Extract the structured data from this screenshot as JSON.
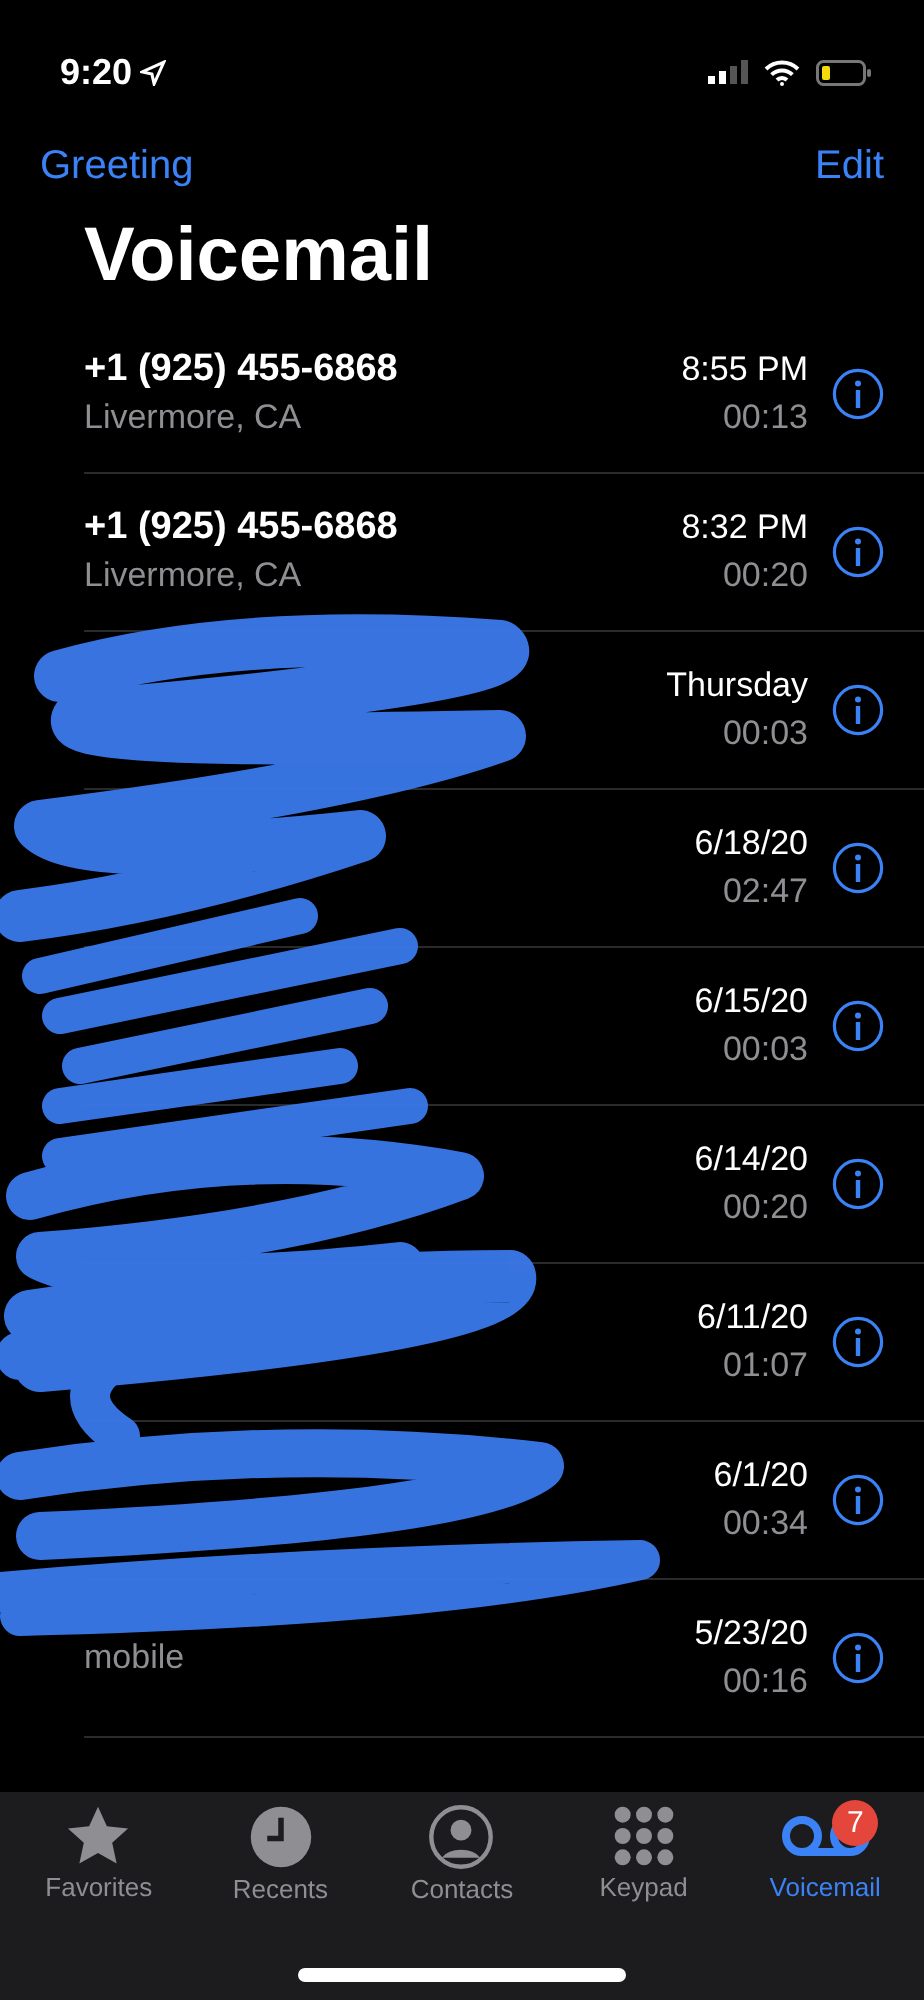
{
  "status_bar": {
    "time": "9:20"
  },
  "nav": {
    "left": "Greeting",
    "right": "Edit"
  },
  "title": "Voicemail",
  "voicemails": [
    {
      "caller": "+1 (925) 455-6868",
      "detail": "Livermore, CA",
      "when": "8:55 PM",
      "duration": "00:13"
    },
    {
      "caller": "+1 (925) 455-6868",
      "detail": "Livermore, CA",
      "when": "8:32 PM",
      "duration": "00:20"
    },
    {
      "when": "Thursday",
      "duration": "00:03"
    },
    {
      "when": "6/18/20",
      "duration": "02:47"
    },
    {
      "when": "6/15/20",
      "duration": "00:03"
    },
    {
      "when": "6/14/20",
      "duration": "00:20"
    },
    {
      "when": "6/11/20",
      "duration": "01:07"
    },
    {
      "when": "6/1/20",
      "duration": "00:34"
    },
    {
      "detail": "mobile",
      "when": "5/23/20",
      "duration": "00:16"
    }
  ],
  "tabs": [
    {
      "label": "Favorites",
      "kind": "star",
      "selected": false
    },
    {
      "label": "Recents",
      "kind": "clock",
      "selected": false
    },
    {
      "label": "Contacts",
      "kind": "person",
      "selected": false
    },
    {
      "label": "Keypad",
      "kind": "keypad",
      "selected": false
    },
    {
      "label": "Voicemail",
      "kind": "voicemail",
      "selected": true,
      "badge": "7"
    }
  ]
}
